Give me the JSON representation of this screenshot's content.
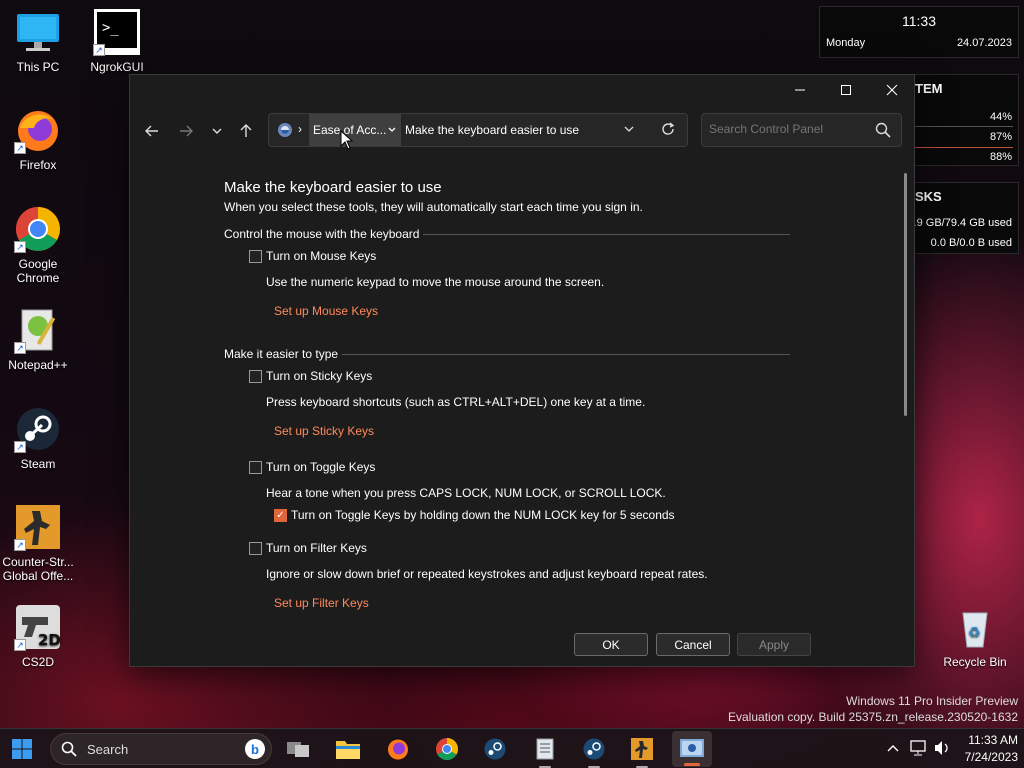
{
  "desktop": {
    "icons": [
      {
        "label": "This PC"
      },
      {
        "label": "NgrokGUI"
      },
      {
        "label": "Firefox"
      },
      {
        "label": "Google Chrome"
      },
      {
        "label": "Notepad++"
      },
      {
        "label": "Steam"
      },
      {
        "label": "Counter-Str... Global Offe..."
      },
      {
        "label": "CS2D"
      },
      {
        "label": "Recycle Bin"
      }
    ]
  },
  "widget": {
    "time": "11:33",
    "day": "Monday",
    "date": "24.07.2023",
    "system_title": "TEM",
    "system_values": [
      "44%",
      "87%",
      "88%"
    ],
    "disks_title": "SKS",
    "disk_values": [
      ".9 GB/79.4 GB used",
      "0.0 B/0.0 B used"
    ]
  },
  "window": {
    "address": {
      "crumb": "Ease of Acc...",
      "current": "Make the keyboard easier to use"
    },
    "search_placeholder": "Search Control Panel",
    "title": "Make the keyboard easier to use",
    "subtitle": "When you select these tools, they will automatically start each time you sign in.",
    "sections": {
      "mouse": {
        "heading": "Control the mouse with the keyboard",
        "mouse_keys_label": "Turn on Mouse Keys",
        "mouse_keys_desc": "Use the numeric keypad to move the mouse around the screen.",
        "mouse_keys_link": "Set up Mouse Keys"
      },
      "type": {
        "heading": "Make it easier to type",
        "sticky_label": "Turn on Sticky Keys",
        "sticky_desc": "Press keyboard shortcuts (such as CTRL+ALT+DEL) one key at a time.",
        "sticky_link": "Set up Sticky Keys",
        "toggle_label": "Turn on Toggle Keys",
        "toggle_desc": "Hear a tone when you press CAPS LOCK, NUM LOCK, or SCROLL LOCK.",
        "toggle_hold_label": "Turn on Toggle Keys by holding down the NUM LOCK key for 5 seconds",
        "filter_label": "Turn on Filter Keys",
        "filter_desc": "Ignore or slow down brief or repeated keystrokes and adjust keyboard repeat rates.",
        "filter_link": "Set up Filter Keys"
      }
    },
    "buttons": {
      "ok": "OK",
      "cancel": "Cancel",
      "apply": "Apply"
    }
  },
  "watermark": {
    "line1": "Windows 11 Pro Insider Preview",
    "line2": "Evaluation copy. Build 25375.zn_release.230520-1632"
  },
  "taskbar": {
    "search_label": "Search",
    "clock_time": "11:33 AM",
    "clock_date": "7/24/2023"
  },
  "colors": {
    "accent_link": "#ff8a5c",
    "checkbox_checked": "#e0663a",
    "window_bg": "#1c1c1c"
  }
}
